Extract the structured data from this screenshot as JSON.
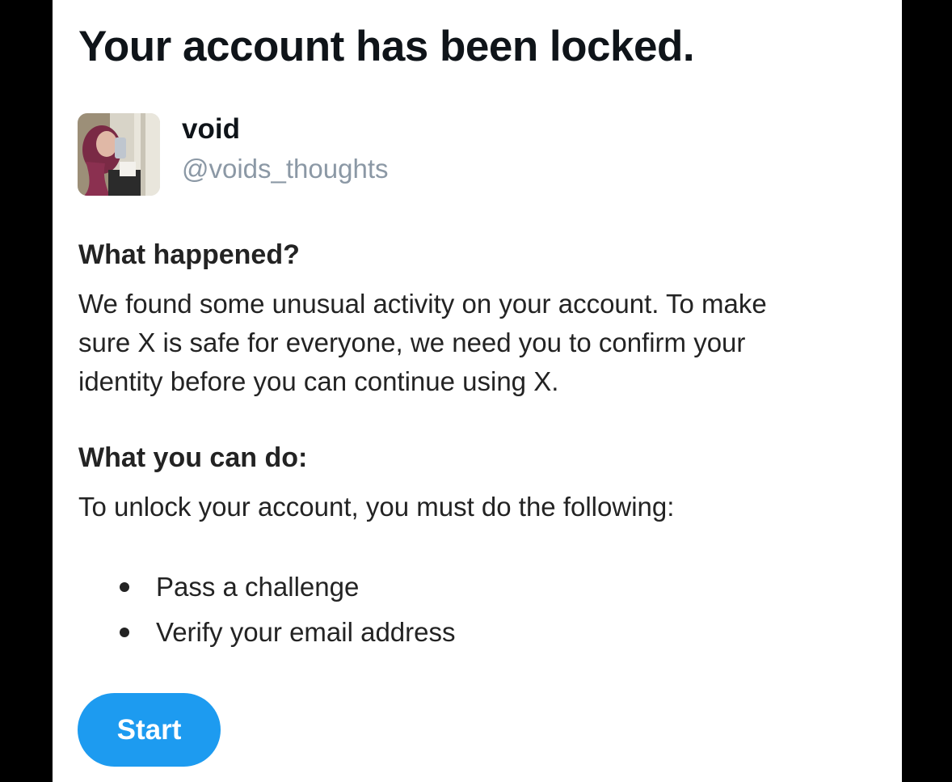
{
  "title": "Your account has been locked.",
  "user": {
    "display_name": "void",
    "handle": "@voids_thoughts"
  },
  "what_happened": {
    "heading": "What happened?",
    "lines": [
      "We found some unusual activity on your account. To make",
      "sure X is safe for everyone, we need you to confirm your",
      "identity before you can continue using X."
    ]
  },
  "what_you_can_do": {
    "heading": "What you can do:",
    "intro": "To unlock your account, you must do the following:",
    "steps": [
      "Pass a challenge",
      "Verify your email address"
    ]
  },
  "start_button": {
    "label": "Start"
  },
  "colors": {
    "accent": "#1d9bf0",
    "handle_gray": "#8b98a5",
    "text": "#232323",
    "background_frame": "#000000"
  }
}
